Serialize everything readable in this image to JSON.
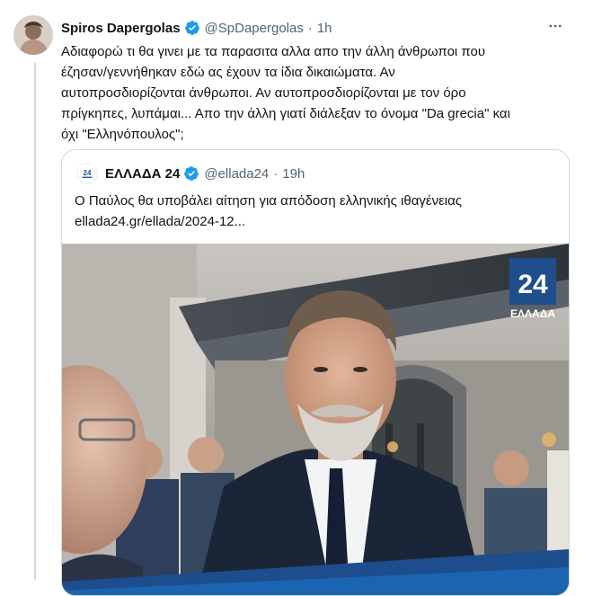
{
  "tweet": {
    "display_name": "Spiros Dapergolas",
    "handle": "@SpDapergolas",
    "separator": "·",
    "time": "1h",
    "text": "Αδιαφορώ τι θα γινει με τα παρασιτα αλλα απο την άλλη άνθρωποι που\nέζησαν/γεννήθηκαν εδώ ας έχουν τα ίδια δικαιώματα. Αν\nαυτοπροσδιορίζονται άνθρωποι. Αν αυτοπροσδιορίζονται με τον όρο\nπρίγκηπες, λυπάμαι... Απο την άλλη γιατί διάλεξαν το όνομα \"Da grecia\" και\nόχι \"Ελληνόπουλος\";"
  },
  "quote": {
    "display_name": "ΕΛΛΑΔΑ 24",
    "handle": "@ellada24",
    "separator": "·",
    "time": "19h",
    "text": "Ο Παύλος θα υποβάλει αίτηση για απόδοση ελληνικής ιθαγένειας",
    "link": "ellada24.gr/ellada/2024-12...",
    "media_logo_number": "24",
    "media_logo_text": "ΕΛΛΑΔΑ",
    "avatar_logo_text": "24"
  },
  "colors": {
    "verified": "#1d9bf0",
    "muted": "#536471",
    "border": "#cfd9de",
    "logo_blue": "#1f4e8c"
  },
  "icons": [
    "verified-badge-icon",
    "more-options-icon"
  ]
}
